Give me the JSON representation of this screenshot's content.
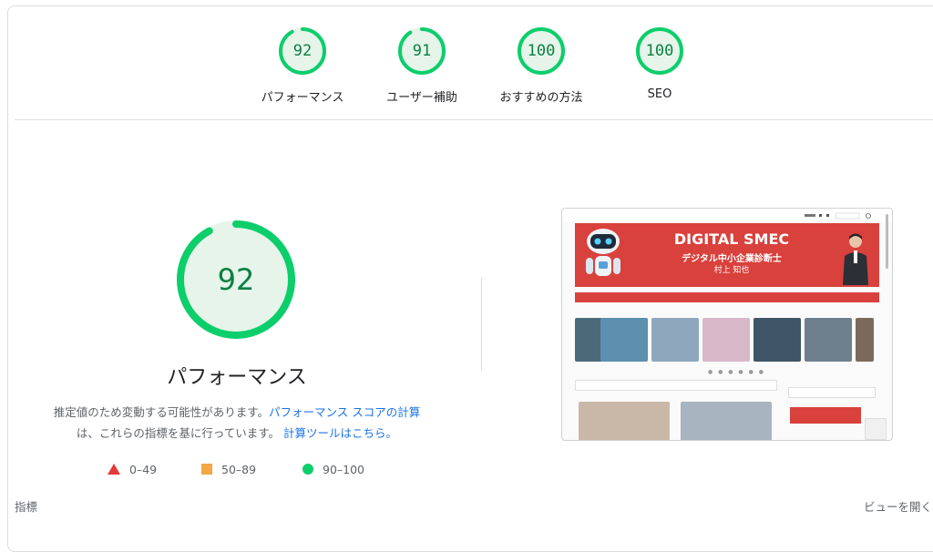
{
  "category_scores": [
    {
      "score": "92",
      "label": "パフォーマンス",
      "value": 92
    },
    {
      "score": "91",
      "label": "ユーザー補助",
      "value": 91
    },
    {
      "score": "100",
      "label": "おすすめの方法",
      "value": 100
    },
    {
      "score": "100",
      "label": "SEO",
      "value": 100
    }
  ],
  "main": {
    "score": "92",
    "score_value": 92,
    "title": "パフォーマンス",
    "desc_part1": "推定値のため変動する可能性があります。",
    "desc_link1": "パフォーマンス スコアの計算",
    "desc_part2": "は、これらの指標を基に行っています。",
    "desc_link2": "計算ツールはこちら。"
  },
  "legend": {
    "fail": "0–49",
    "average": "50–89",
    "pass": "90–100"
  },
  "screenshot": {
    "banner_title": "DIGITAL SMEC",
    "banner_sub": "デジタル中小企業診断士",
    "banner_name": "村上 知也"
  },
  "footer": {
    "metrics_label": "指標",
    "view_label": "ビューを開く"
  },
  "colors": {
    "pass": "#0cce6b",
    "pass_text": "#0b8043",
    "pass_bg": "#e6f4ea",
    "average": "#f4a742",
    "fail": "#e53935",
    "link": "#1a73e8"
  }
}
